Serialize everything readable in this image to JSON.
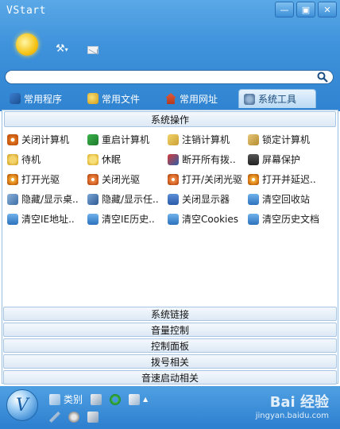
{
  "window": {
    "title": "VStart",
    "buttons": [
      "minimize",
      "skin",
      "close"
    ]
  },
  "toolbar": {
    "icons": [
      "weather-sun-icon",
      "wrench-icon",
      "mail-icon"
    ]
  },
  "search": {
    "value": "",
    "placeholder": ""
  },
  "tabs": [
    {
      "label": "常用程序",
      "icon": "book-icon",
      "active": false
    },
    {
      "label": "常用文件",
      "icon": "fruit-icon",
      "active": false
    },
    {
      "label": "常用网址",
      "icon": "house-icon",
      "active": false
    },
    {
      "label": "系统工具",
      "icon": "gear-person-icon",
      "active": true
    }
  ],
  "main": {
    "section_title": "系统操作",
    "items": [
      {
        "label": "关闭计算机",
        "icon": "power-icon"
      },
      {
        "label": "重启计算机",
        "icon": "restart-icon"
      },
      {
        "label": "注销计算机",
        "icon": "logout-icon"
      },
      {
        "label": "锁定计算机",
        "icon": "lock-icon"
      },
      {
        "label": "待机",
        "icon": "standby-icon"
      },
      {
        "label": "休眠",
        "icon": "sleep-icon"
      },
      {
        "label": "断开所有拨..",
        "icon": "disconnect-icon"
      },
      {
        "label": "屏幕保护",
        "icon": "screensaver-icon"
      },
      {
        "label": "打开光驱",
        "icon": "cd-open-icon"
      },
      {
        "label": "关闭光驱",
        "icon": "cd-close-icon"
      },
      {
        "label": "打开/关闭光驱",
        "icon": "cd-toggle-icon"
      },
      {
        "label": "打开并延迟..",
        "icon": "cd-delay-icon"
      },
      {
        "label": "隐藏/显示桌..",
        "icon": "hide-desktop-icon"
      },
      {
        "label": "隐藏/显示任..",
        "icon": "hide-taskbar-icon"
      },
      {
        "label": "关闭显示器",
        "icon": "monitor-off-icon"
      },
      {
        "label": "清空回收站",
        "icon": "recycle-bin-icon"
      },
      {
        "label": "清空IE地址..",
        "icon": "clear-ie-address-icon"
      },
      {
        "label": "清空IE历史..",
        "icon": "clear-ie-history-icon"
      },
      {
        "label": "清空Cookies",
        "icon": "clear-cookies-icon"
      },
      {
        "label": "清空历史文档",
        "icon": "clear-docs-icon"
      }
    ]
  },
  "sections": [
    {
      "label": "系统链接"
    },
    {
      "label": "音量控制"
    },
    {
      "label": "控制面板"
    },
    {
      "label": "拨号相关"
    },
    {
      "label": "音速启动相关"
    }
  ],
  "footer": {
    "category_label": "类别",
    "icons": [
      "category-icon",
      "add-icon",
      "refresh-icon",
      "new-doc-icon",
      "wrench-icon",
      "gears-icon",
      "window-grid-icon"
    ],
    "watermark": "Bai 经验",
    "watermark_url": "jingyan.baidu.com"
  }
}
